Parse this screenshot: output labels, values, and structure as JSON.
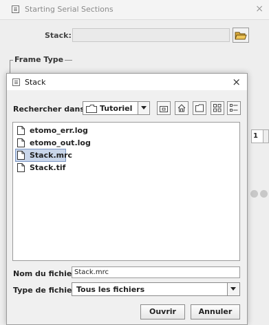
{
  "parent_window": {
    "title": "Starting Serial Sections",
    "close_glyph": "×",
    "stack_label": "Stack:",
    "stack_value": "",
    "frame_type_label": "Frame Type",
    "spinner_value": "1"
  },
  "dialog": {
    "title": "Stack",
    "close_glyph": "×",
    "look_in_label": "Rechercher dans :",
    "look_in_value": "Tutoriel",
    "toolbar_icons": [
      "up-folder-icon",
      "home-icon",
      "new-folder-icon",
      "list-view-icon",
      "details-view-icon"
    ],
    "files": [
      {
        "name": "etomo_err.log",
        "selected": false
      },
      {
        "name": "etomo_out.log",
        "selected": false
      },
      {
        "name": "Stack.mrc",
        "selected": true
      },
      {
        "name": "Stack.tif",
        "selected": false
      }
    ],
    "file_name_label": "Nom du fichier :",
    "file_name_value": "Stack.mrc",
    "file_type_label": "Type de fichier :",
    "file_type_value": "Tous les fichiers",
    "open_button": "Ouvrir",
    "cancel_button": "Annuler"
  },
  "colors": {
    "selection_bg": "#c9d6ea",
    "selection_border": "#7a95c2",
    "window_bg": "#f0f0f0"
  }
}
